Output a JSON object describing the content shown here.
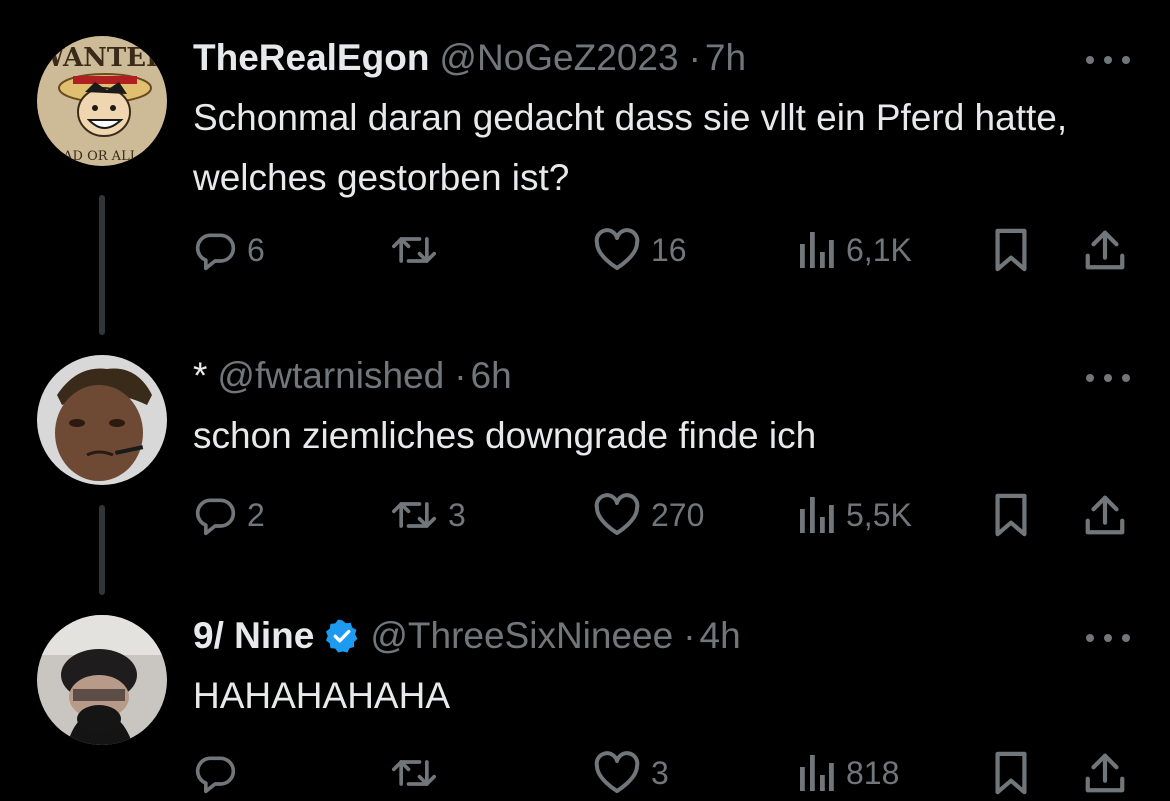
{
  "tweets": [
    {
      "name": "TheRealEgon",
      "handle": "@NoGeZ2023",
      "time": "7h",
      "text": "Schonmal daran gedacht dass sie vllt ein Pferd hatte, welches gestorben ist?",
      "avatar_text_top": "WANTED",
      "avatar_text_bottom": "AD OR ALI",
      "replies": "6",
      "retweets": "",
      "likes": "16",
      "views": "6,1K",
      "verified": false
    },
    {
      "name": "*",
      "handle": "@fwtarnished",
      "time": "6h",
      "text": "schon ziemliches downgrade finde ich",
      "replies": "2",
      "retweets": "3",
      "likes": "270",
      "views": "5,5K",
      "verified": false
    },
    {
      "name": "9/ Nine",
      "handle": "@ThreeSixNineee",
      "time": "4h",
      "text": "HAHAHAHAHA",
      "replies": "",
      "retweets": "",
      "likes": "3",
      "views": "818",
      "verified": true
    }
  ],
  "separator": "·",
  "colors": {
    "background": "#000000",
    "text": "#e7e9ea",
    "secondary": "#71767b",
    "verified": "#1d9bf0",
    "thread_line": "#333639"
  },
  "icons": [
    "reply-icon",
    "retweet-icon",
    "like-icon",
    "views-icon",
    "bookmark-icon",
    "share-icon",
    "more-icon",
    "verified-badge-icon"
  ]
}
